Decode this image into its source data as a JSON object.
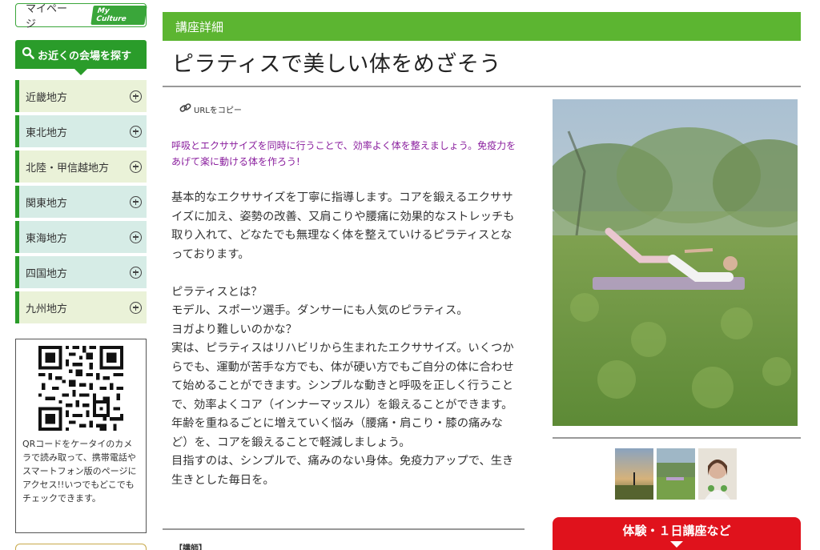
{
  "sidebar": {
    "mypage_label": "マイページ",
    "mycult_label": "My Culture",
    "search_label": "お近くの会場を探す",
    "regions": [
      {
        "label": "近畿地方"
      },
      {
        "label": "東北地方"
      },
      {
        "label": "北陸・甲信越地方"
      },
      {
        "label": "関東地方"
      },
      {
        "label": "東海地方"
      },
      {
        "label": "四国地方"
      },
      {
        "label": "九州地方"
      }
    ],
    "qr_text": "QRコードをケータイのカメラで読み取って、携帯電話やスマートフォン版のページにアクセス!!いつでもどこでもチェックできます。"
  },
  "main": {
    "section_label": "講座詳細",
    "title": "ピラティスで美しい体をめざそう",
    "url_copy_label": "URLをコピー",
    "lead": "呼吸とエクササイズを同時に行うことで、効率よく体を整えましょう。免疫力をあげて楽に動ける体を作ろう!",
    "paragraph1": "基本的なエクササイズを丁寧に指導します。コアを鍛えるエクササイズに加え、姿勢の改善、又肩こりや腰痛に効果的なストレッチも取り入れて、どなたでも無理なく体を整えていけるピラティスとなっております。",
    "lines": [
      "ピラティスとは？",
      "モデル、スポーツ選手。ダンサーにも人気のピラティス。",
      "ヨガより難しいのかな？",
      "実は、ピラティスはリハビリから生まれたエクササイズ。いくつからでも、運動が苦手な方でも、体が硬い方でもご自分の体に合わせて始めることができます。シンプルな動きと呼吸を正しく行うことで、効率よくコア（インナーマッスル）を鍛えることができます。",
      "年齢を重ねるごとに増えていく悩み（腰痛・肩こり・膝の痛みなど）を、コアを鍛えることで軽減しましょう。",
      "目指すのは、シンプルで、痛みのない身体。免疫力アップで、生き生きとした毎日を。"
    ],
    "teacher_label": "【講師】"
  },
  "aside": {
    "trial_label": "体験・１日講座など"
  },
  "colors": {
    "green": "#5cb531",
    "dark_green": "#2a9c2a",
    "purple": "#8a1f9e",
    "red": "#e0121c"
  }
}
